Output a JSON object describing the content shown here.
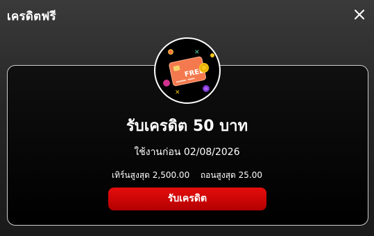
{
  "modal": {
    "title": "เครดิตฟรี",
    "close_icon": "close-icon"
  },
  "promo": {
    "badge_icon": "free-credit-card-icon",
    "badge_card_text": "FREE",
    "headline": "รับเครดิต 50 บาท",
    "use_before_label": "ใช้งานก่อน",
    "use_before_date": "02/08/2026",
    "min_turnover_label": "เทิร์นสูงสุด",
    "min_turnover_value": "2,500.00",
    "max_withdraw_label": "ถอนสูงสุด",
    "max_withdraw_value": "25.00",
    "claim_button_label": "รับเครดิต"
  },
  "colors": {
    "button_red": "#d40000",
    "card_orange": "#f4794e",
    "coin_yellow": "#f5c518"
  }
}
